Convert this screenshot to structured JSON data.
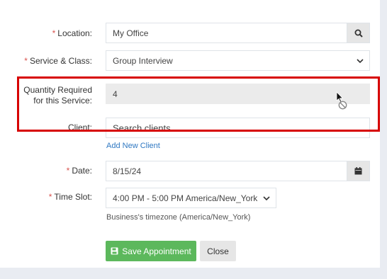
{
  "form": {
    "location": {
      "required_mark": "*",
      "label": "Location:",
      "value": "My Office",
      "button_icon": "search-icon"
    },
    "service": {
      "required_mark": "*",
      "label": "Service & Class:",
      "value": "Group Interview",
      "dropdown_icon": "chevron-down-icon"
    },
    "quantity": {
      "label_line1": "Quantity Required",
      "label_line2": "for this Service:",
      "value": "4"
    },
    "client": {
      "label": "Client:",
      "placeholder": "Search clients",
      "add_link": "Add New Client"
    },
    "date": {
      "required_mark": "*",
      "label": "Date:",
      "value": "8/15/24",
      "button_icon": "calendar-icon"
    },
    "time_slot": {
      "required_mark": "*",
      "label": "Time Slot:",
      "value": "4:00 PM - 5:00 PM America/New_York",
      "hint": "Business's timezone (America/New_York)"
    }
  },
  "actions": {
    "save_label": "Save Appointment",
    "close_label": "Close"
  },
  "colors": {
    "required": "#d9534f",
    "link": "#2f78c2",
    "save_button": "#5cb85c",
    "highlight": "#d70000"
  }
}
